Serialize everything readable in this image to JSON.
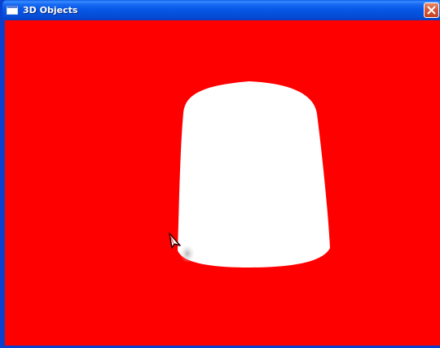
{
  "window": {
    "title": "3D Objects",
    "title_icon": "window-icon",
    "close_icon": "close-icon"
  },
  "scene": {
    "background_color": "#ff0000",
    "object_color": "#ffffff",
    "object": "cylinder",
    "cursor": "arrow-cursor-icon"
  }
}
